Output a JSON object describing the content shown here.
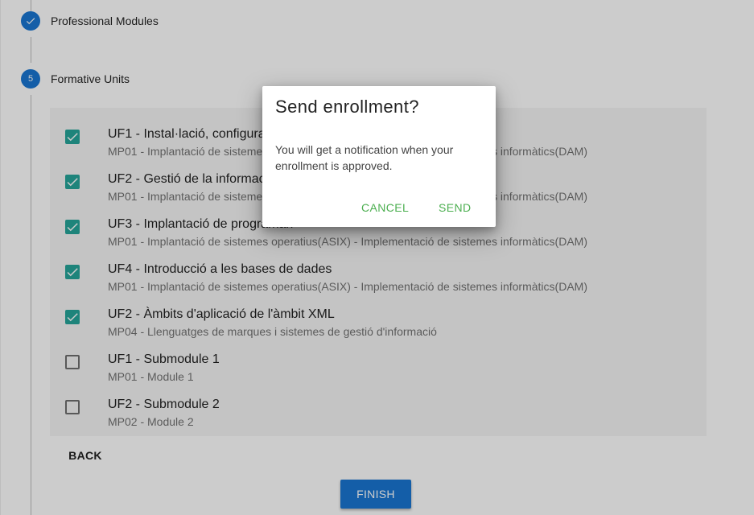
{
  "stepper": {
    "steps": [
      {
        "number": "",
        "label": "Professional Modules",
        "icon": "check-icon",
        "state": "completed"
      },
      {
        "number": "5",
        "label": "Formative Units",
        "state": "active"
      }
    ]
  },
  "units": [
    {
      "title": "UF1 - Instal·lació, configuració",
      "subtitle": "MP01 - Implantació de sistemes operatius(ASIX) - Implementació de sistemes informàtics(DAM)",
      "checked": true
    },
    {
      "title": "UF2 - Gestió de la informació",
      "subtitle": "MP01 - Implantació de sistemes operatius(ASIX) - Implementació de sistemes informàtics(DAM)",
      "checked": true
    },
    {
      "title": "UF3 - Implantació de programari",
      "subtitle": "MP01 - Implantació de sistemes operatius(ASIX) - Implementació de sistemes informàtics(DAM)",
      "checked": true
    },
    {
      "title": "UF4 - Introducció a les bases de dades",
      "subtitle": "MP01 - Implantació de sistemes operatius(ASIX) - Implementació de sistemes informàtics(DAM)",
      "checked": true
    },
    {
      "title": "UF2 - Àmbits d'aplicació de l'àmbit XML",
      "subtitle": "MP04 - Llenguatges de marques i sistemes de gestió d'informació",
      "checked": true
    },
    {
      "title": "UF1 - Submodule 1",
      "subtitle": "MP01 - Module 1",
      "checked": false
    },
    {
      "title": "UF2 - Submodule 2",
      "subtitle": "MP02 - Module 2",
      "checked": false
    }
  ],
  "actions": {
    "back_label": "BACK",
    "finish_label": "FINISH"
  },
  "dialog": {
    "title": "Send enrollment?",
    "body": "You will get a notification when your enrollment is approved.",
    "cancel_label": "CANCEL",
    "send_label": "SEND"
  },
  "colors": {
    "primary": "#1976d2",
    "checkbox": "#26a69a",
    "dialog_action": "#4caf50"
  }
}
